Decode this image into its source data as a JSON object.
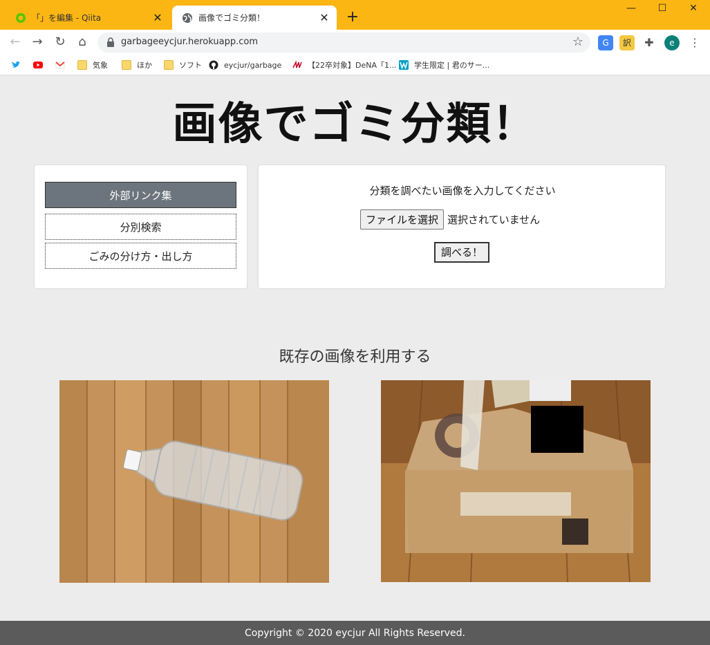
{
  "browser": {
    "tabs": [
      {
        "title": "「」を編集 - Qiita",
        "active": false
      },
      {
        "title": "画像でゴミ分類！",
        "active": true
      }
    ],
    "new_tab": "+",
    "url": "garbageeycjur.herokuapp.com",
    "extensions": {
      "translate_label": "訳",
      "profile_initial": "e"
    },
    "window_controls": {
      "minimize": "—",
      "maximize": "☐",
      "close": "✕"
    },
    "bookmarks": [
      {
        "label": "",
        "icon": "twitter-icon"
      },
      {
        "label": "",
        "icon": "youtube-icon"
      },
      {
        "label": "",
        "icon": "gmail-icon"
      },
      {
        "label": "気象",
        "icon": "folder-icon"
      },
      {
        "label": "ほか",
        "icon": "folder-icon"
      },
      {
        "label": "ソフト",
        "icon": "folder-icon"
      },
      {
        "label": "eycjur/garbage",
        "icon": "github-icon"
      },
      {
        "label": "【22卒対象】DeNA「1...",
        "icon": "dena-icon"
      },
      {
        "label": "学生限定 | 君のサー...",
        "icon": "w-icon"
      }
    ]
  },
  "page": {
    "title": "画像でゴミ分類！",
    "menu": [
      {
        "label": "外部リンク集",
        "style": "primary"
      },
      {
        "label": "分別検索",
        "style": "outline"
      },
      {
        "label": "ごみの分け方・出し方",
        "style": "outline"
      }
    ],
    "upload": {
      "prompt": "分類を調べたい画像を入力してください",
      "file_button": "ファイルを選択",
      "file_status": "選択されていません",
      "submit": "調べる！"
    },
    "samples": {
      "title": "既存の画像を利用する"
    },
    "footer": "Copyright © 2020 eycjur All Rights Reserved."
  },
  "colors": {
    "chrome_accent": "#fbb614",
    "primary_button": "#6c757d",
    "footer": "#5b5b5b",
    "page_bg": "#ececec"
  }
}
